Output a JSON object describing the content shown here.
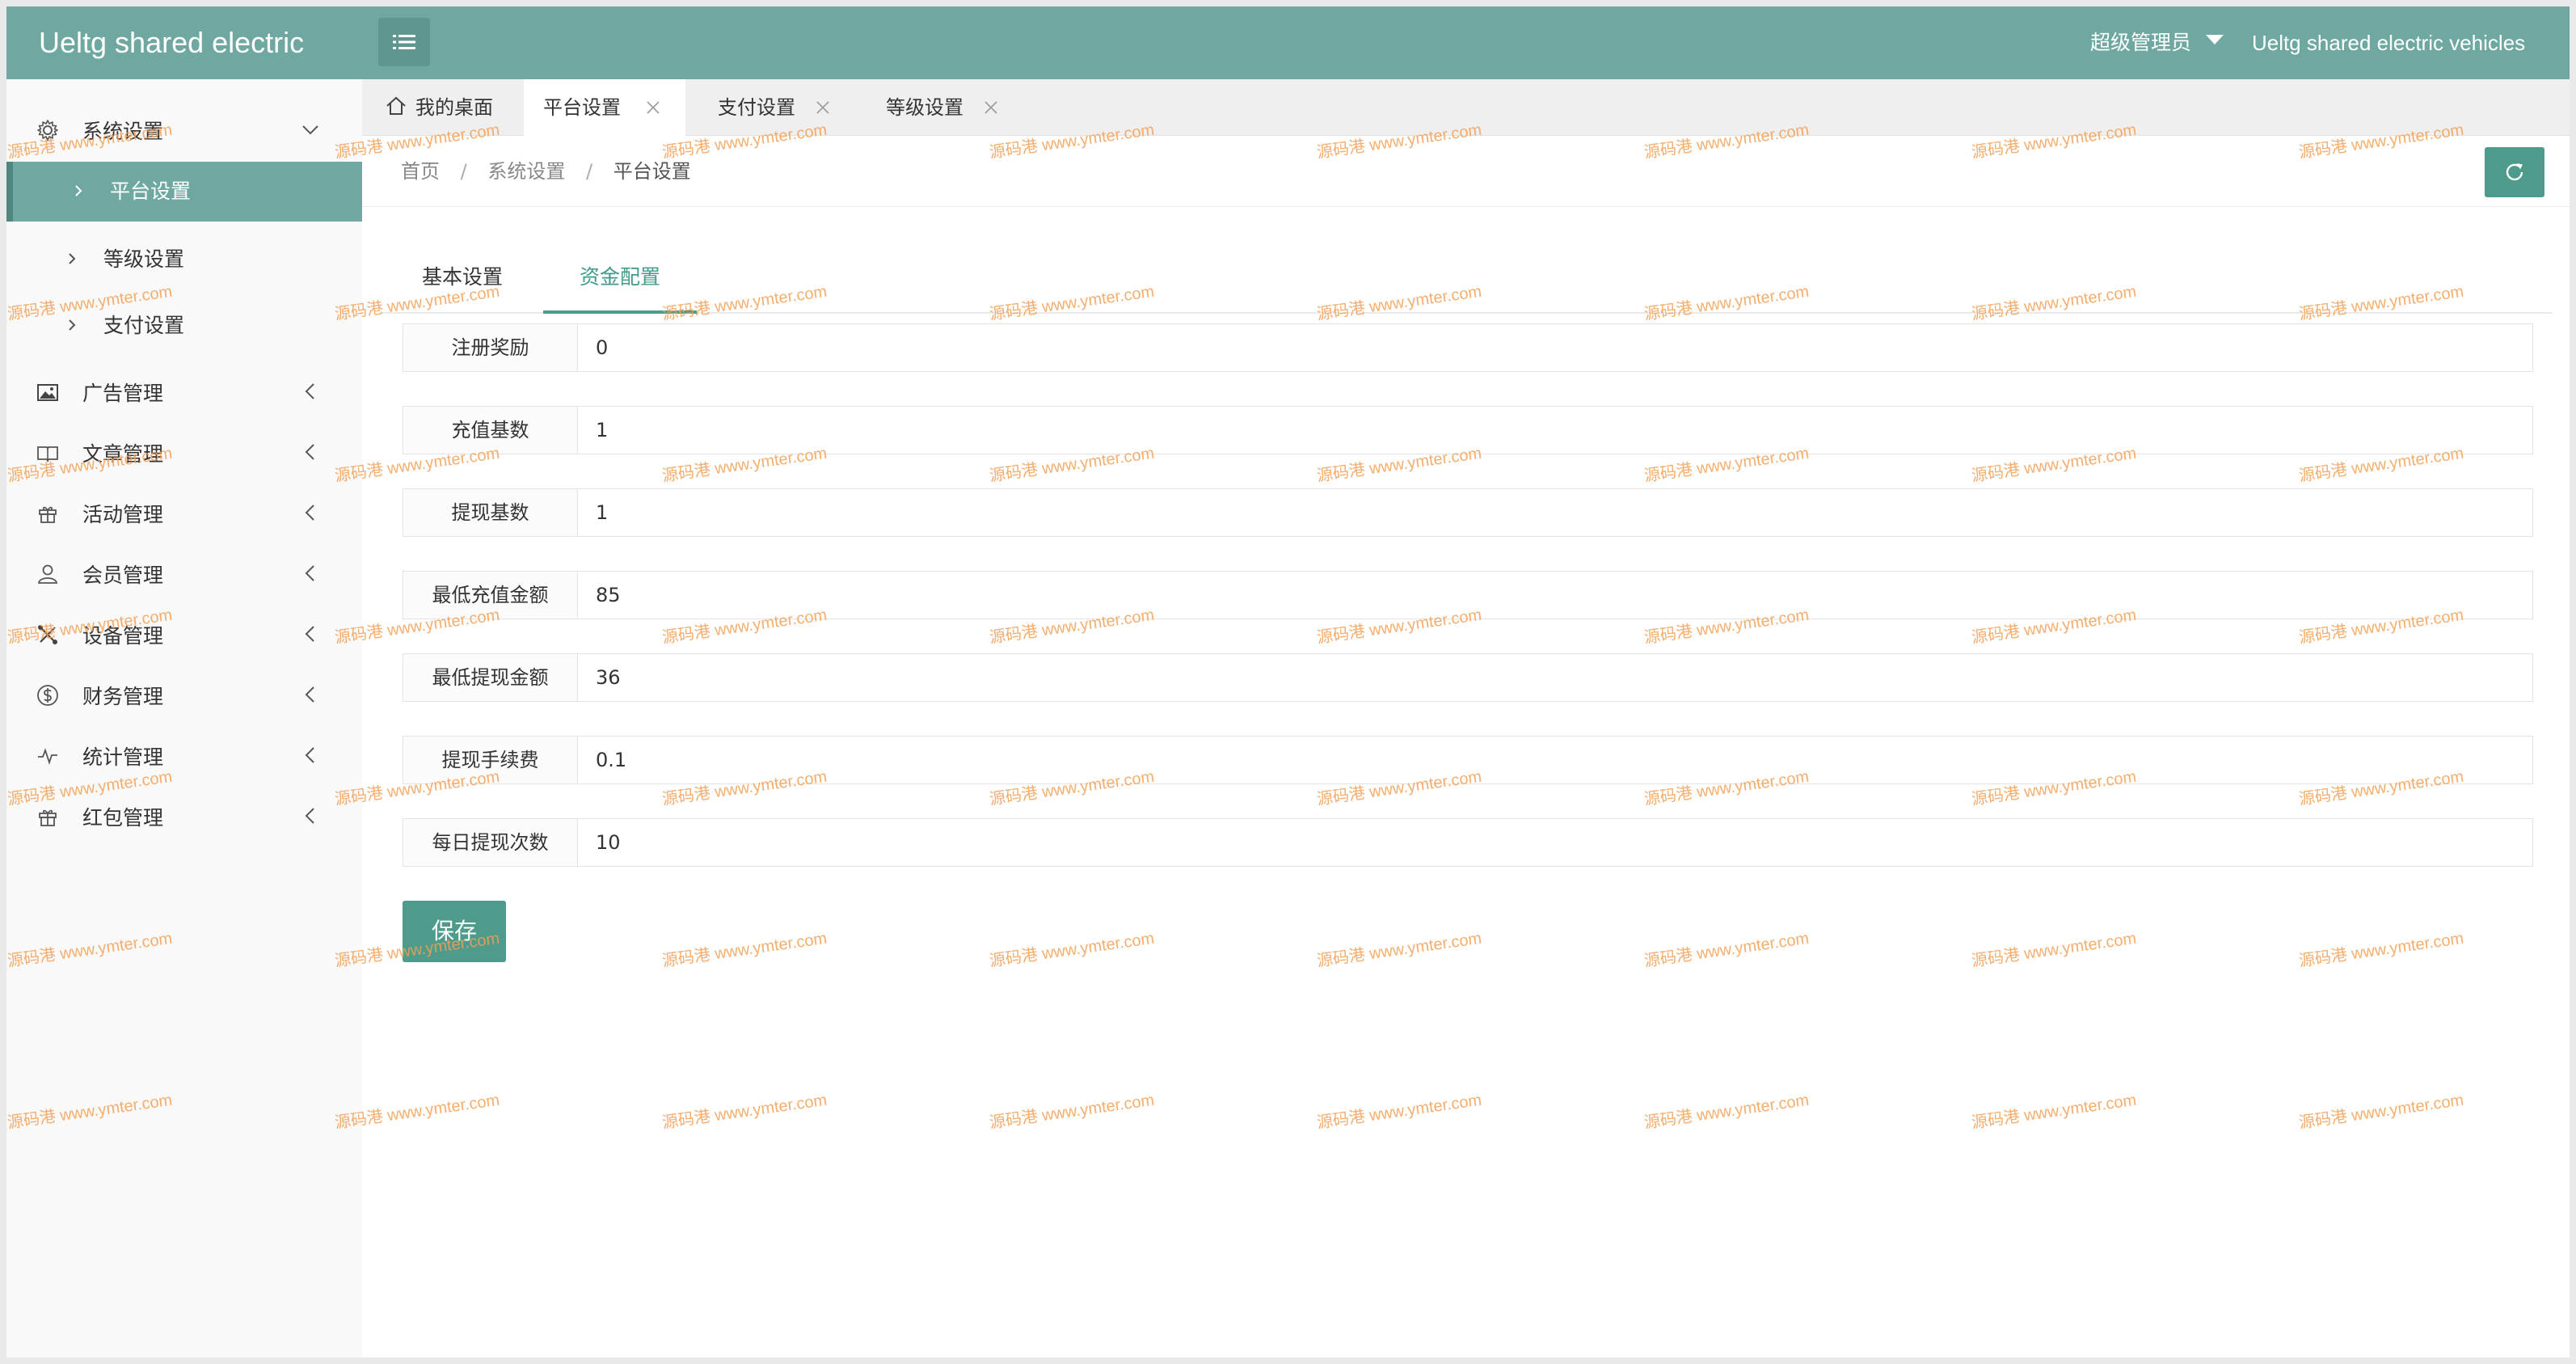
{
  "header": {
    "brand": "Ueltg shared electric",
    "admin_label": "超级管理员",
    "right_title": "Ueltg shared electric vehicles"
  },
  "sidebar": {
    "items": [
      {
        "label": "系统设置",
        "icon": "gear-icon",
        "expanded": true
      },
      {
        "label": "广告管理",
        "icon": "image-icon"
      },
      {
        "label": "文章管理",
        "icon": "book-icon"
      },
      {
        "label": "活动管理",
        "icon": "gift-icon"
      },
      {
        "label": "会员管理",
        "icon": "user-icon"
      },
      {
        "label": "设备管理",
        "icon": "tools-icon"
      },
      {
        "label": "财务管理",
        "icon": "dollar-icon"
      },
      {
        "label": "统计管理",
        "icon": "pulse-icon"
      },
      {
        "label": "红包管理",
        "icon": "gift-icon"
      }
    ],
    "sub_items": [
      {
        "label": "平台设置",
        "active": true
      },
      {
        "label": "等级设置"
      },
      {
        "label": "支付设置"
      }
    ]
  },
  "tabs": [
    {
      "label": "我的桌面",
      "icon": "home-icon"
    },
    {
      "label": "平台设置",
      "active": true
    },
    {
      "label": "支付设置"
    },
    {
      "label": "等级设置"
    }
  ],
  "breadcrumb": {
    "home": "首页",
    "sep": "/",
    "section": "系统设置",
    "current": "平台设置"
  },
  "content_tabs": [
    {
      "label": "基本设置"
    },
    {
      "label": "资金配置",
      "active": true
    }
  ],
  "form": {
    "fields": [
      {
        "label": "注册奖励",
        "value": "0"
      },
      {
        "label": "充值基数",
        "value": "1"
      },
      {
        "label": "提现基数",
        "value": "1"
      },
      {
        "label": "最低充值金额",
        "value": "85"
      },
      {
        "label": "最低提现金额",
        "value": "36"
      },
      {
        "label": "提现手续费",
        "value": "0.1"
      },
      {
        "label": "每日提现次数",
        "value": "10"
      }
    ],
    "save_label": "保存"
  },
  "watermark": {
    "text": "源码港 www.ymter.com"
  },
  "colors": {
    "header_bg": "#6fa8a0",
    "accent": "#4e9a8b",
    "watermark": "#f4a055"
  }
}
